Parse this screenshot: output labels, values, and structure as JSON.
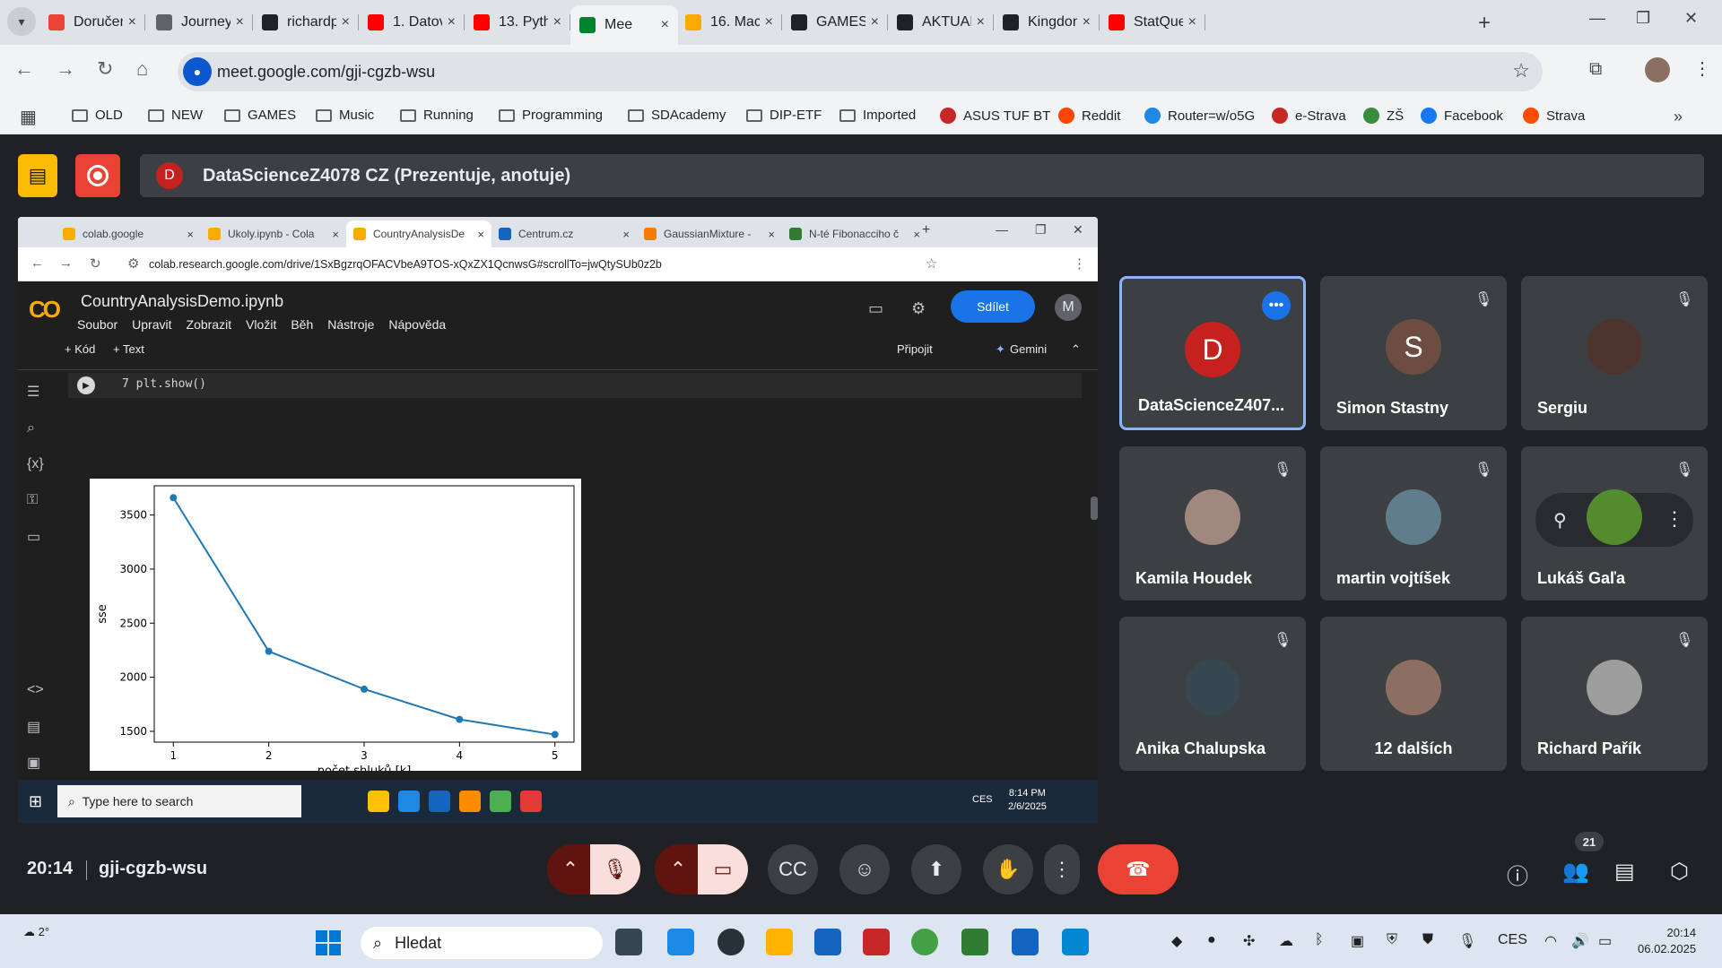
{
  "outer_browser": {
    "tabs": [
      {
        "label": "Doručen",
        "color": "#ea4335"
      },
      {
        "label": "Journey",
        "color": "#5f6368"
      },
      {
        "label": "richardp",
        "color": "#202124"
      },
      {
        "label": "1. Datov",
        "color": "#ff0000"
      },
      {
        "label": "13. Pyth",
        "color": "#ff0000"
      },
      {
        "label": "Mee",
        "color": "#00832d"
      },
      {
        "label": "16. Mac",
        "color": "#f9ab00"
      },
      {
        "label": "GAMES.",
        "color": "#202124"
      },
      {
        "label": "AKTUAL",
        "color": "#202124"
      },
      {
        "label": "Kingdon",
        "color": "#202124"
      },
      {
        "label": "StatQue",
        "color": "#ff0000"
      }
    ],
    "url": "meet.google.com/gji-cgzb-wsu",
    "bookmarks": [
      "OLD",
      "NEW",
      "GAMES",
      "Music",
      "Running",
      "Programming",
      "SDAcademy",
      "DIP-ETF",
      "Imported",
      "ASUS TUF BT",
      "Reddit",
      "Router=w/o5G",
      "e-Strava",
      "ZŠ",
      "Facebook",
      "Strava"
    ]
  },
  "meet": {
    "presenter_initial": "D",
    "presenter_title": "DataScienceZ4078 CZ (Prezentuje, anotuje)",
    "time": "20:14",
    "meeting_code": "gji-cgzb-wsu",
    "participant_count": "21",
    "participants": [
      {
        "name": "DataScienceZ407...",
        "initial": "D",
        "color": "#c5221f"
      },
      {
        "name": "Simon Stastny",
        "initial": "S",
        "color": "#6d4c41"
      },
      {
        "name": "Sergiu",
        "initial": "",
        "color": "#4e342e"
      },
      {
        "name": "Kamila Houdek",
        "initial": "",
        "color": "#a1887f"
      },
      {
        "name": "martin vojtíšek",
        "initial": "",
        "color": "#607d8b"
      },
      {
        "name": "Lukáš Gaľa",
        "initial": "",
        "color": "#558b2f"
      },
      {
        "name": "Anika Chalupska",
        "initial": "",
        "color": "#37474f"
      },
      {
        "name": "12 dalších",
        "initial": "",
        "color": "#8d6e63"
      },
      {
        "name": "Richard Pařík",
        "initial": "",
        "color": "#9e9e9e"
      }
    ]
  },
  "shared_screen": {
    "tabs": [
      {
        "label": "colab.google",
        "color": "#f9ab00"
      },
      {
        "label": "Ukoly.ipynb - Cola",
        "color": "#f9ab00"
      },
      {
        "label": "CountryAnalysisDe",
        "color": "#f9ab00"
      },
      {
        "label": "Centrum.cz",
        "color": "#1565c0"
      },
      {
        "label": "GaussianMixture -",
        "color": "#f57c00"
      },
      {
        "label": "N-té Fibonacciho č",
        "color": "#2e7d32"
      }
    ],
    "url": "colab.research.google.com/drive/1SxBgzrqOFACVbeA9TOS-xQxZX1QcnwsG#scrollTo=jwQtySUb0z2b",
    "colab": {
      "logo": "CO",
      "filename": "CountryAnalysisDemo.ipynb",
      "menu": [
        "Soubor",
        "Upravit",
        "Zobrazit",
        "Vložit",
        "Běh",
        "Nástroje",
        "Nápověda"
      ],
      "share_label": "Sdílet",
      "avatar": "M",
      "add_code": "+ Kód",
      "add_text": "+ Text",
      "connect": "Připojit",
      "gemini": "Gemini",
      "code_line": "7 plt.show()"
    },
    "taskbar": {
      "search": "Type here to search",
      "lang": "CES",
      "time": "8:14 PM",
      "date": "2/6/2025"
    }
  },
  "chart_data": {
    "type": "line",
    "x": [
      1,
      2,
      3,
      4,
      5
    ],
    "values": [
      3660,
      2240,
      1890,
      1610,
      1470
    ],
    "xlabel": "počet shluků [k]",
    "ylabel": "sse",
    "yticks": [
      1500,
      2000,
      2500,
      3000,
      3500
    ],
    "xticks": [
      1,
      2,
      3,
      4,
      5
    ],
    "ylim": [
      1400,
      3770
    ],
    "xlim": [
      0.8,
      5.2
    ],
    "color": "#1f77b4"
  },
  "taskbar": {
    "weather": "2°",
    "search": "Hledat",
    "lang": "CES",
    "time": "20:14",
    "date": "06.02.2025"
  }
}
